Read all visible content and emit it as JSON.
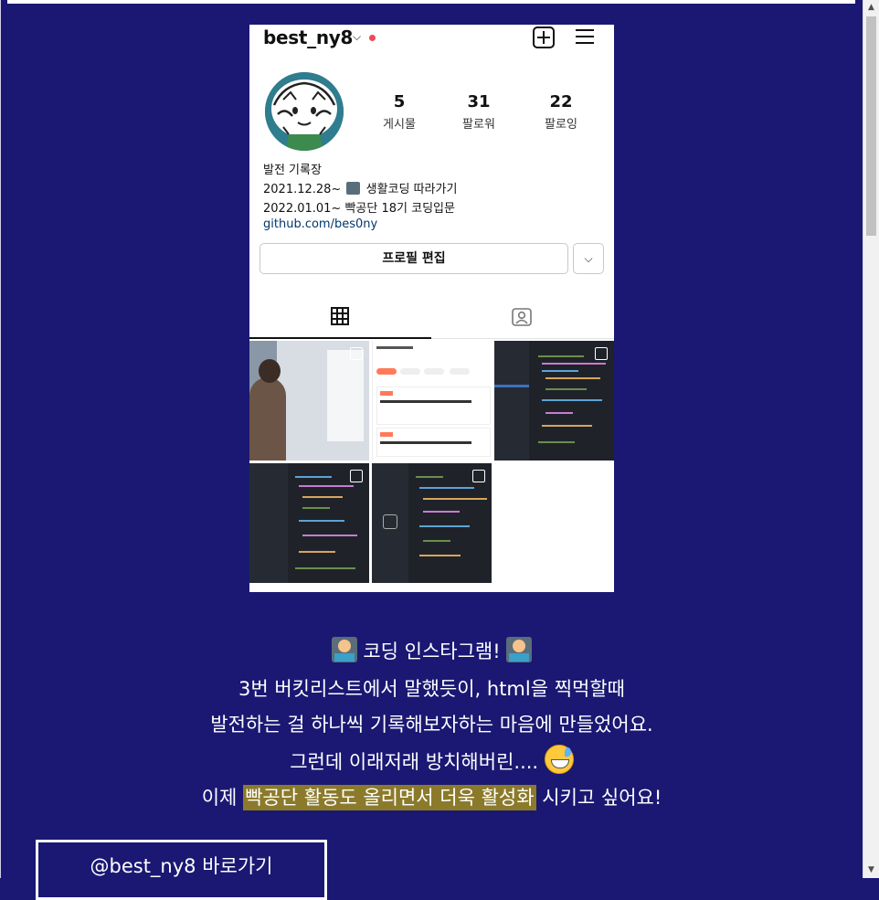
{
  "profile": {
    "username": "best_ny8",
    "stats": [
      {
        "value": "5",
        "label": "게시물"
      },
      {
        "value": "31",
        "label": "팔로워"
      },
      {
        "value": "22",
        "label": "팔로잉"
      }
    ],
    "bio": {
      "name": "발전 기록장",
      "line1_prefix": "2021.12.28~",
      "line1_suffix": "생활코딩 따라가기",
      "line2": "2022.01.01~ 빡공단 18기 코딩입문",
      "link": "github.com/bes0ny"
    },
    "edit_button": "프로필 편집"
  },
  "description": {
    "title": "코딩 인스타그램!",
    "line1": "3번 버킷리스트에서 말했듯이, html을 찍먹할때",
    "line2": "발전하는 걸 하나씩 기록해보자하는 마음에 만들었어요.",
    "line3": "그런데 이래저래 방치해버린....",
    "line4_prefix": "이제",
    "line4_highlight": "빡공단 활동도 올리면서 더욱 활성화",
    "line4_suffix": "시키고 싶어요!"
  },
  "link_button": "@best_ny8 바로가기",
  "colors": {
    "background": "#1a1873",
    "highlight": "#8b7a2a",
    "notification_dot": "#ed4956"
  }
}
